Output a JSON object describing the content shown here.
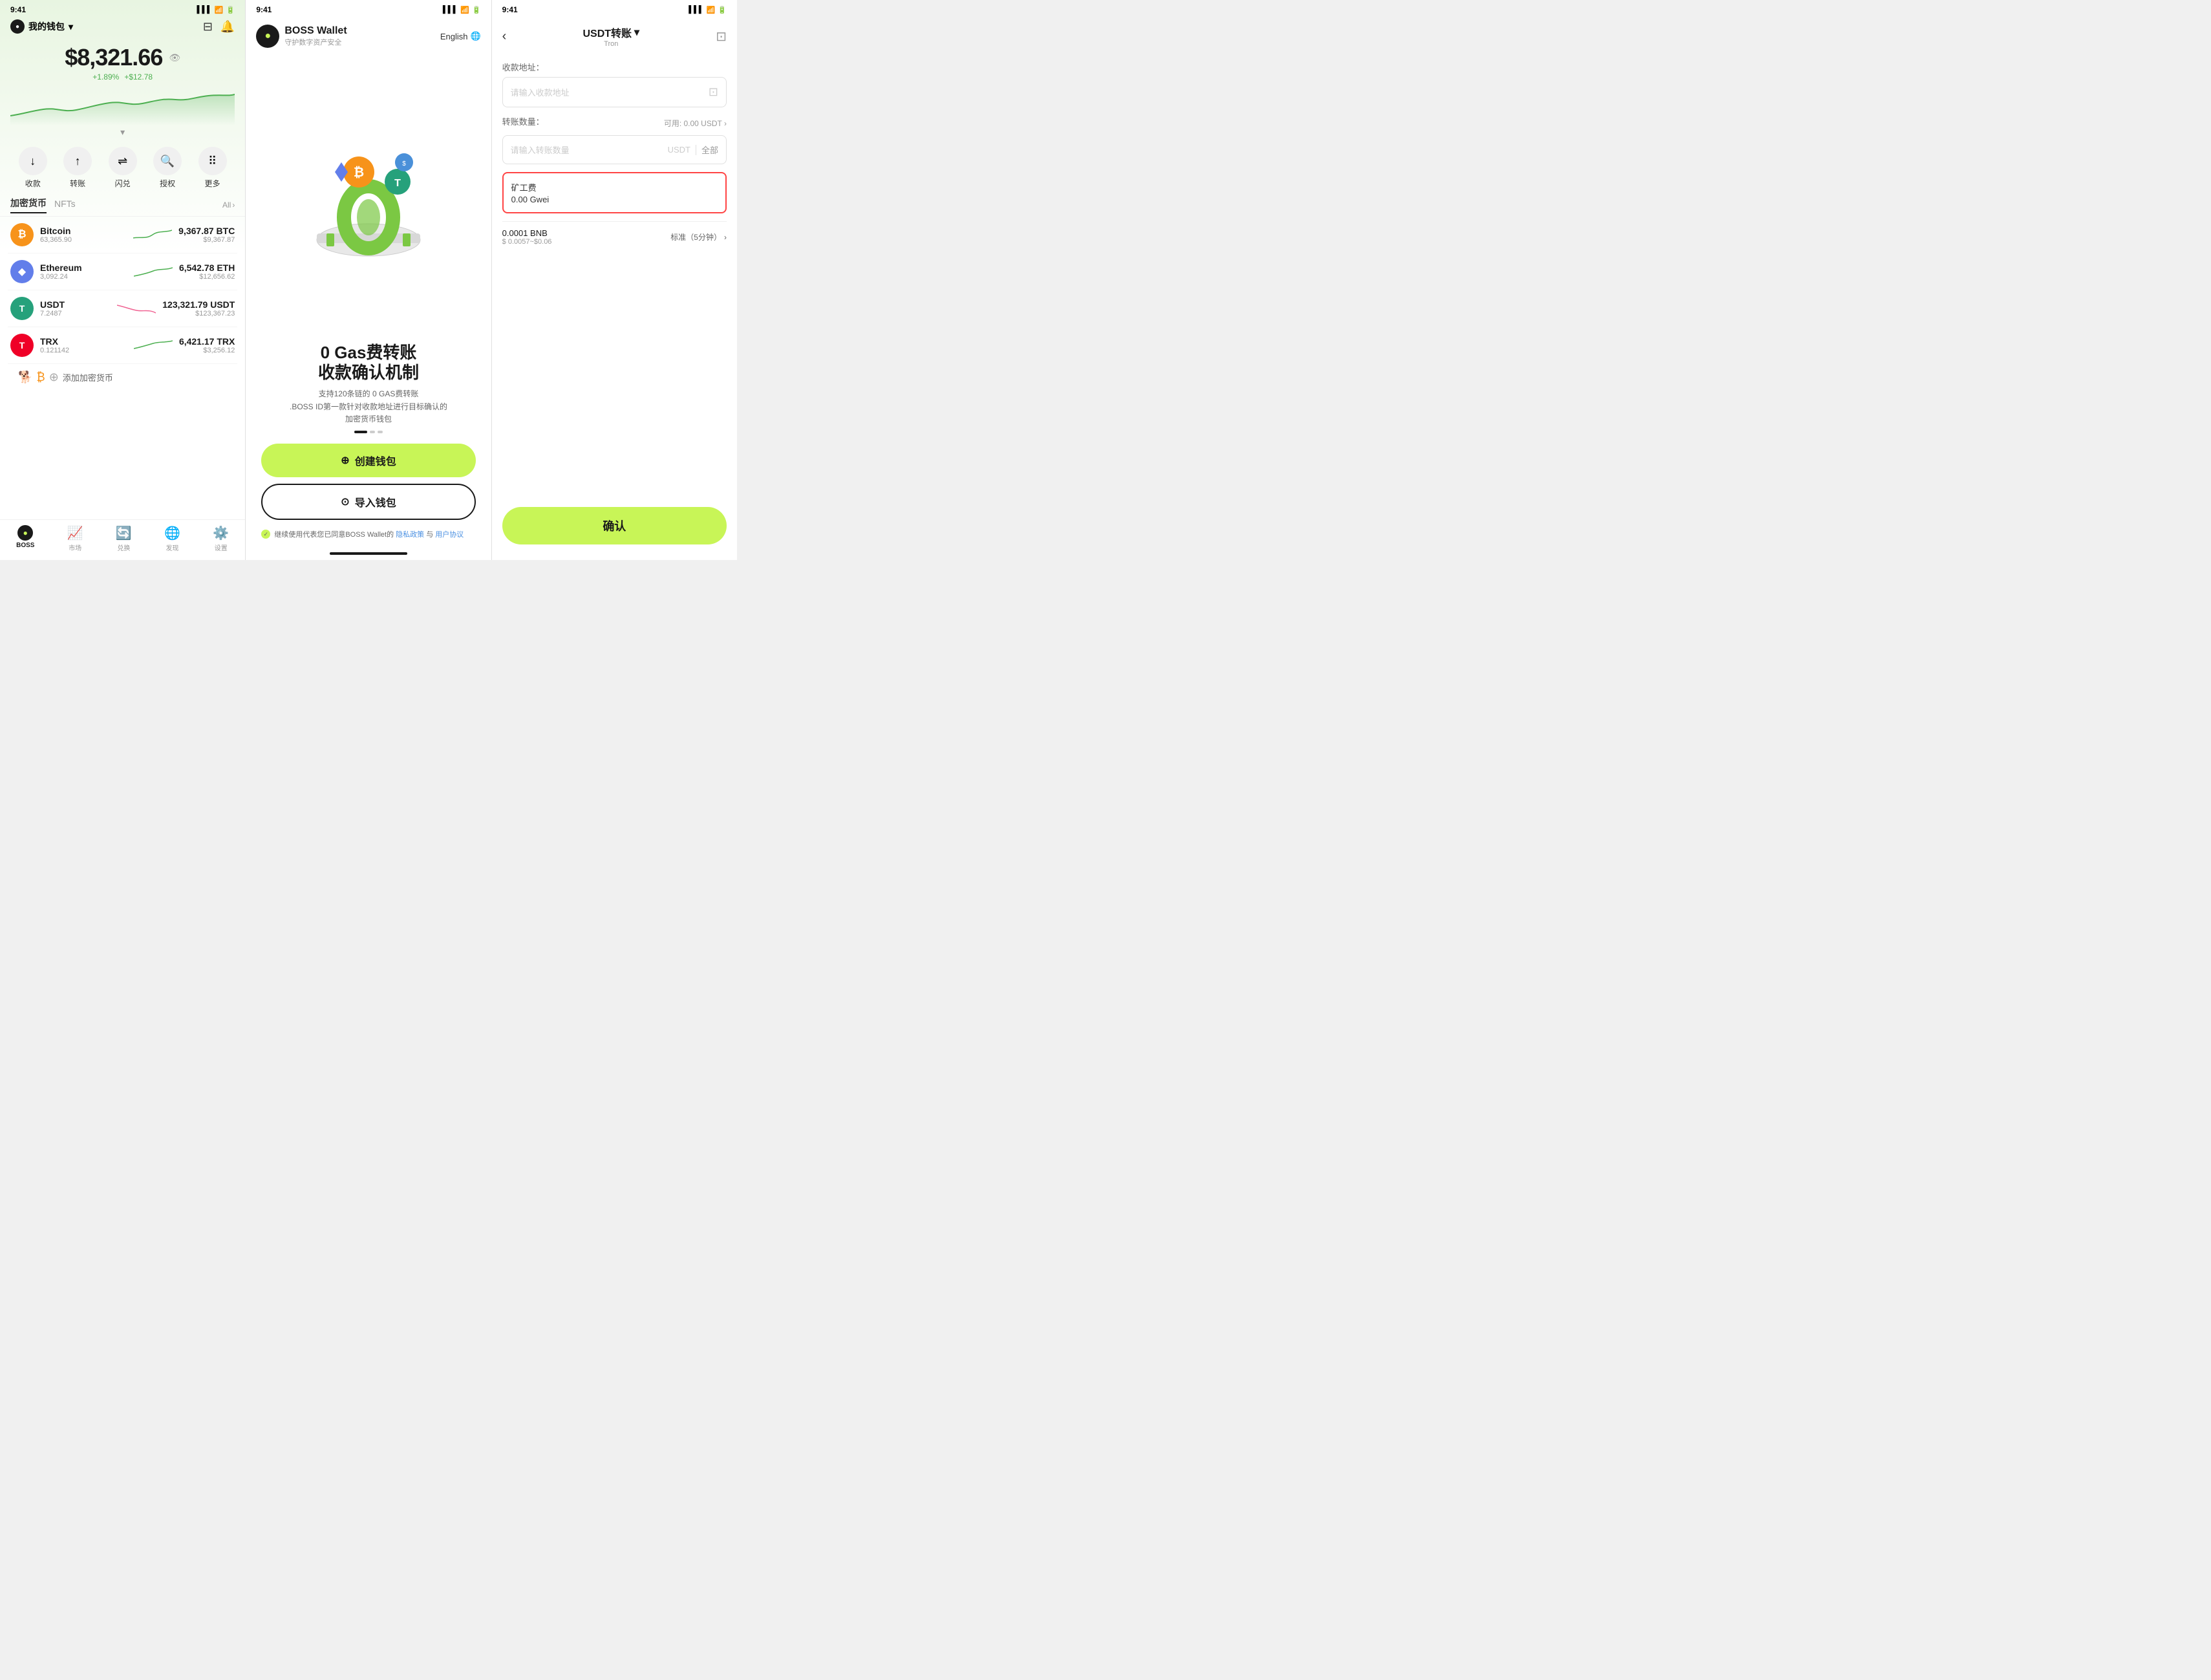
{
  "panel1": {
    "status_time": "9:41",
    "wallet_name": "我的钱包",
    "balance": "$8,321.66",
    "change_pct": "+1.89%",
    "change_amt": "+$12.78",
    "collapse_icon": "▾",
    "actions": [
      {
        "label": "收款",
        "icon": "↓"
      },
      {
        "label": "转账",
        "icon": "↑"
      },
      {
        "label": "闪兑",
        "icon": "⇌"
      },
      {
        "label": "授权",
        "icon": "🔍"
      },
      {
        "label": "更多",
        "icon": "⠿"
      }
    ],
    "tab_crypto": "加密货币",
    "tab_nfts": "NFTs",
    "tab_all": "All",
    "cryptos": [
      {
        "name": "Bitcoin",
        "sub": "63,365.90",
        "amount": "9,367.87 BTC",
        "usd": "$9,367.87",
        "color": "#f7931a",
        "trend": "up"
      },
      {
        "name": "Ethereum",
        "sub": "3,092.24",
        "amount": "6,542.78 ETH",
        "usd": "$12,656.62",
        "color": "#627eea",
        "trend": "up"
      },
      {
        "name": "USDT",
        "sub": "7.2487",
        "amount": "123,321.79 USDT",
        "usd": "$123,367.23",
        "color": "#26a17b",
        "trend": "down"
      },
      {
        "name": "TRX",
        "sub": "0.121142",
        "amount": "6,421.17 TRX",
        "usd": "$3,256.12",
        "color": "#ef0027",
        "trend": "up"
      }
    ],
    "add_crypto": "添加加密货币",
    "nav": [
      {
        "label": "BOSS",
        "active": true
      },
      {
        "label": "市场",
        "active": false
      },
      {
        "label": "兑换",
        "active": false
      },
      {
        "label": "发现",
        "active": false
      },
      {
        "label": "设置",
        "active": false
      }
    ]
  },
  "panel2": {
    "status_time": "9:41",
    "boss_name": "BOSS Wallet",
    "boss_sub": "守护数字资产安全",
    "lang": "English",
    "hero_title": "0 Gas费转账\n收款确认机制",
    "hero_desc": "支持120条链的 0 GAS费转账\n.BOSS ID第一款针对收款地址进行目标确认的\n加密货币钱包",
    "btn_create": "创建钱包",
    "btn_import": "导入钱包",
    "terms_pre": "继续使用代表您已同意BOSS Wallet的",
    "terms_privacy": "隐私政策",
    "terms_and": "与",
    "terms_service": "用户协议"
  },
  "panel3": {
    "status_time": "9:41",
    "title": "USDT转账",
    "title_dropdown": "▾",
    "subtitle": "Tron",
    "address_label": "收款地址：",
    "address_placeholder": "请输入收款地址",
    "amount_label": "转账数量：",
    "amount_available": "可用: 0.00 USDT",
    "amount_placeholder": "请输入转账数量",
    "amount_unit": "USDT",
    "amount_all": "全部",
    "fee_title": "矿工费",
    "fee_value": "0.00 Gwei",
    "gas_amount": "0.0001 BNB",
    "gas_usd": "$ 0.0057~$0.06",
    "gas_speed": "标准（5分钟）",
    "btn_confirm": "确认"
  }
}
